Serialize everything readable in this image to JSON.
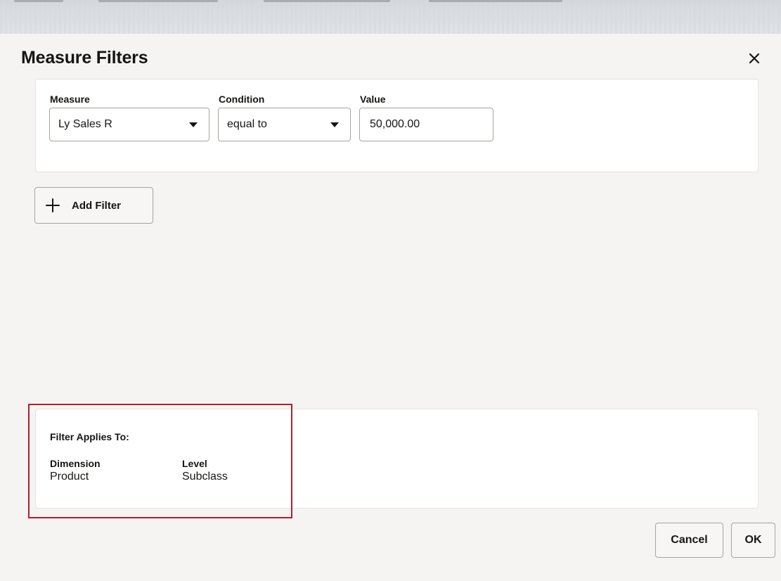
{
  "dialog": {
    "title": "Measure Filters",
    "close_icon": "close-icon"
  },
  "filter_row": {
    "measure_label": "Measure",
    "measure_value": "Ly Sales R",
    "condition_label": "Condition",
    "condition_value": "equal to",
    "value_label": "Value",
    "value_value": "50,000.00"
  },
  "add_filter": {
    "label": "Add Filter",
    "icon": "plus-icon"
  },
  "applies_to": {
    "title": "Filter Applies To:",
    "dimension_label": "Dimension",
    "dimension_value": "Product",
    "level_label": "Level",
    "level_value": "Subclass",
    "highlight_color": "#b0202a"
  },
  "footer": {
    "cancel_label": "Cancel",
    "ok_label": "OK"
  }
}
